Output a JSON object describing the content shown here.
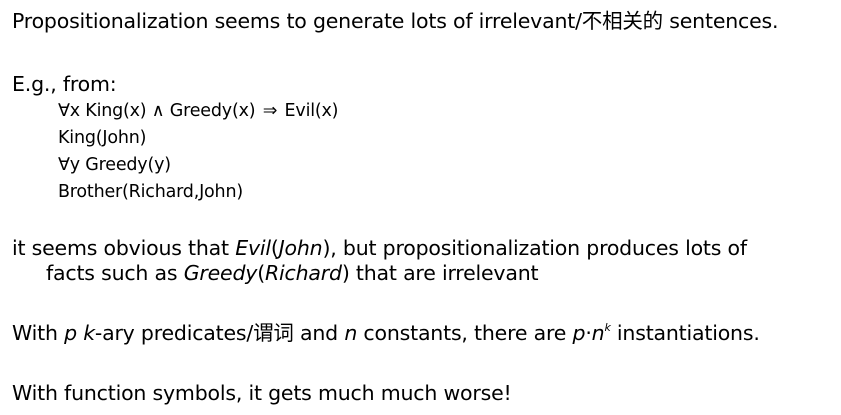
{
  "slide": {
    "intro": "Propositionalization seems to generate lots of irrelevant/不相关的 sentences.",
    "eg_label": "E.g., from:",
    "kb": {
      "rule_quant": "∀x King(x) ∧ Greedy(x) ",
      "rule_arrow": "⇒",
      "rule_tail": " Evil(x)",
      "fact_king": "King(John)",
      "fact_greedy": "∀y Greedy(y)",
      "fact_brother": "Brother(Richard,John)"
    },
    "obvious": {
      "p1": "it seems obvious that ",
      "evil": "Evil",
      "john_open": "(",
      "john": "John",
      "p2": "), but propositionalization produces lots of",
      "indent_p1": "facts such as ",
      "greedy": "Greedy",
      "richard_open": "(",
      "richard": "Richard",
      "indent_p2": ") that are irrelevant"
    },
    "kary": {
      "t1": "With ",
      "p": "p",
      "t2": " ",
      "k": "k",
      "t3": "-ary predicates/谓词 and ",
      "n": "n",
      "t4": " constants, there are ",
      "p2": "p",
      "dot": "·",
      "n2": "n",
      "kexp": "k",
      "t5": " instantiations."
    },
    "worse": "With function symbols, it gets much much worse!"
  }
}
